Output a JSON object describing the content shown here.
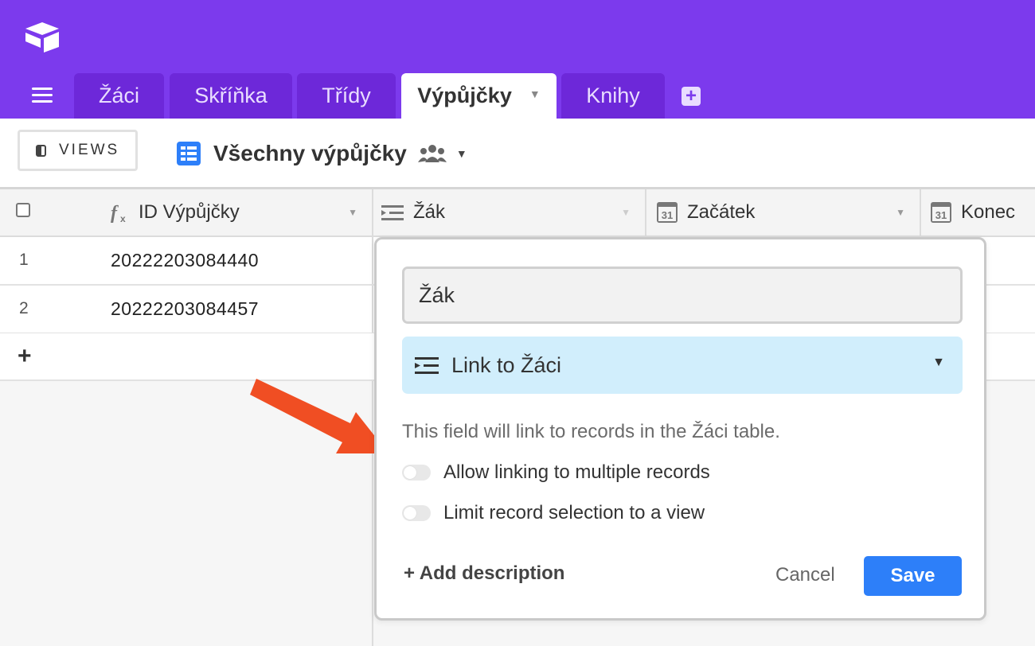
{
  "tabs": [
    {
      "label": "Žáci"
    },
    {
      "label": "Skříňka"
    },
    {
      "label": "Třídy"
    },
    {
      "label": "Výpůjčky",
      "active": true
    },
    {
      "label": "Knihy"
    }
  ],
  "viewsbar": {
    "views_label": "VIEWS",
    "view_name": "Všechny výpůjčky"
  },
  "table": {
    "columns": [
      "ID Výpůjčky",
      "Žák",
      "Začátek",
      "Konec"
    ],
    "rows": [
      {
        "num": "1",
        "id": "20222203084440"
      },
      {
        "num": "2",
        "id": "20222203084457"
      }
    ],
    "add_row_label": "+"
  },
  "popup": {
    "field_name": "Žák",
    "field_type": "Link to Žáci",
    "description": "This field will link to records in the Žáci table.",
    "toggle_multiple": "Allow linking to multiple records",
    "toggle_view": "Limit record selection to a view",
    "add_description": "+ Add description",
    "cancel": "Cancel",
    "save": "Save"
  },
  "icons": {
    "logo": "airtable-logo-icon",
    "menu": "hamburger-icon",
    "add_tab": "plus-square-icon",
    "grid_view": "grid-view-icon",
    "collaborative": "people-icon",
    "formula": "formula-icon",
    "link": "link-field-icon",
    "date": "calendar-icon",
    "annotation_arrow": "red-arrow"
  },
  "colors": {
    "header_bg": "#7c3aed",
    "tab_inactive": "#6d28d9",
    "link_type_bg": "#d1eefc",
    "save_button": "#2d7ff9",
    "arrow": "#f04e23"
  }
}
